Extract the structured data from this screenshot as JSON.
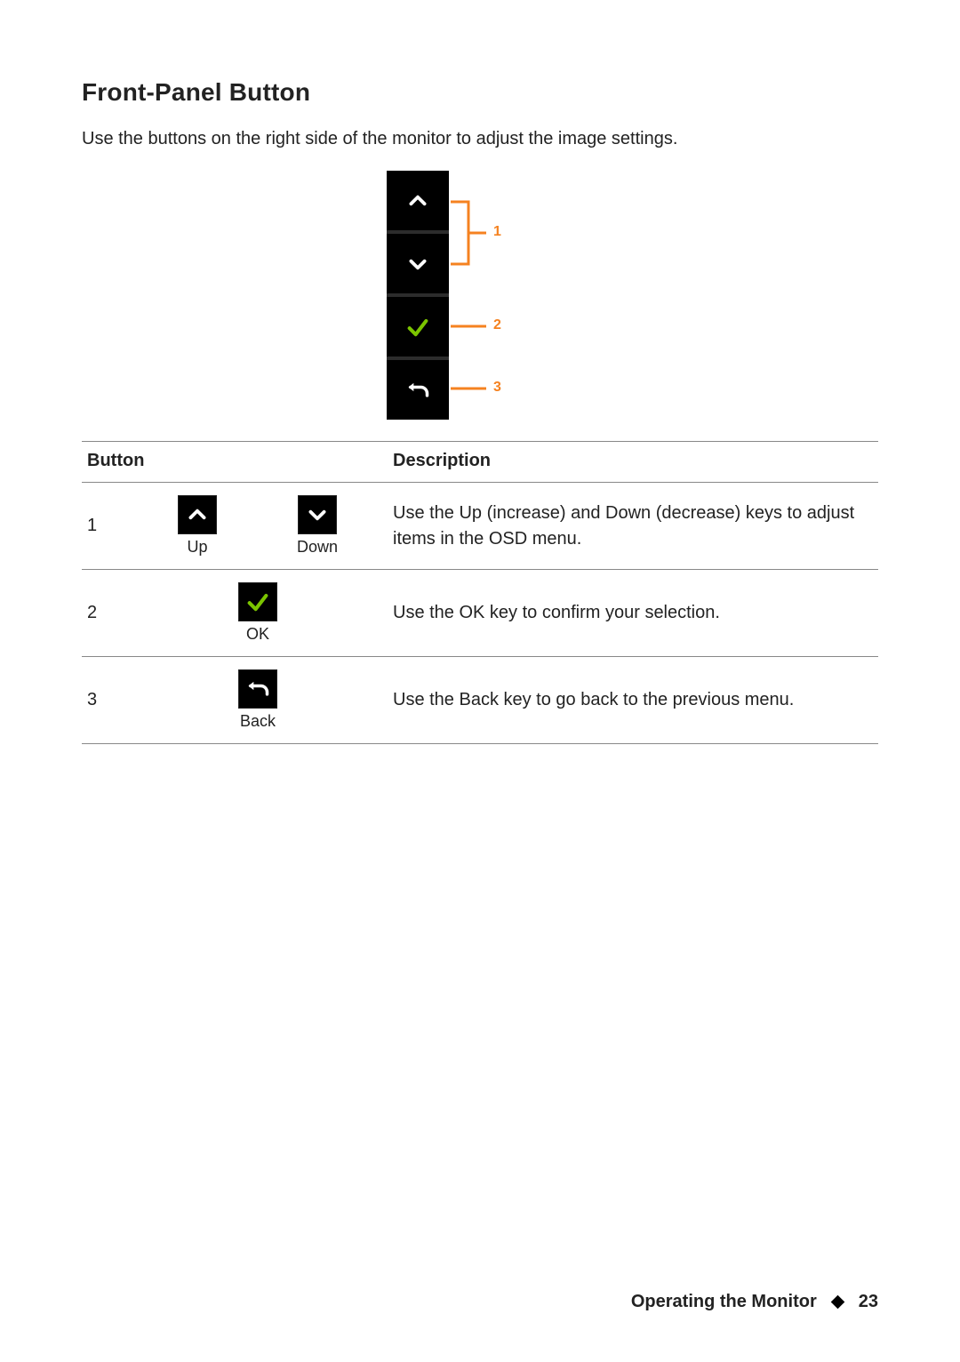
{
  "heading": "Front-Panel Button",
  "intro": "Use the buttons on the right side of the monitor to adjust the image settings.",
  "diagram": {
    "callouts": [
      "1",
      "2",
      "3"
    ]
  },
  "table": {
    "headers": {
      "button": "Button",
      "description": "Description"
    },
    "rows": [
      {
        "num": "1",
        "icons": [
          {
            "name": "up-icon",
            "label": "Up"
          },
          {
            "name": "down-icon",
            "label": "Down"
          }
        ],
        "desc": "Use the Up (increase) and Down (decrease) keys to adjust items in the OSD menu."
      },
      {
        "num": "2",
        "icons": [
          {
            "name": "ok-icon",
            "label": "OK"
          }
        ],
        "desc": "Use the OK key to confirm your selection."
      },
      {
        "num": "3",
        "icons": [
          {
            "name": "back-icon",
            "label": "Back"
          }
        ],
        "desc": "Use the Back key to go back to the previous menu."
      }
    ]
  },
  "footer": {
    "section": "Operating the Monitor",
    "page": "23"
  }
}
